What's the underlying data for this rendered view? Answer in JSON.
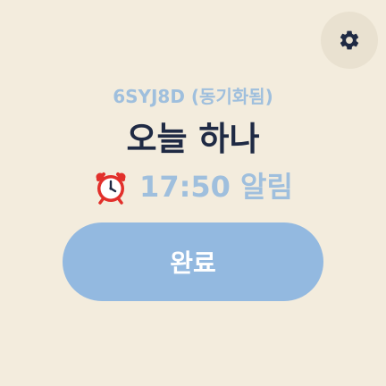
{
  "header": {
    "settings_icon": "gear-icon"
  },
  "main": {
    "code_line": "6SYJ8D (동기화됨)",
    "title": "오늘 하나",
    "alarm": {
      "icon": "alarm-clock-icon",
      "text": "17:50 알림"
    },
    "done_label": "완료"
  },
  "colors": {
    "background": "#f3ecdd",
    "settings_bg": "#e9e1d0",
    "title": "#1f2a44",
    "muted_blue": "#9fbfdd",
    "button_bg": "#93b9e0",
    "button_text": "#ffffff",
    "alarm_red": "#e2302b"
  }
}
